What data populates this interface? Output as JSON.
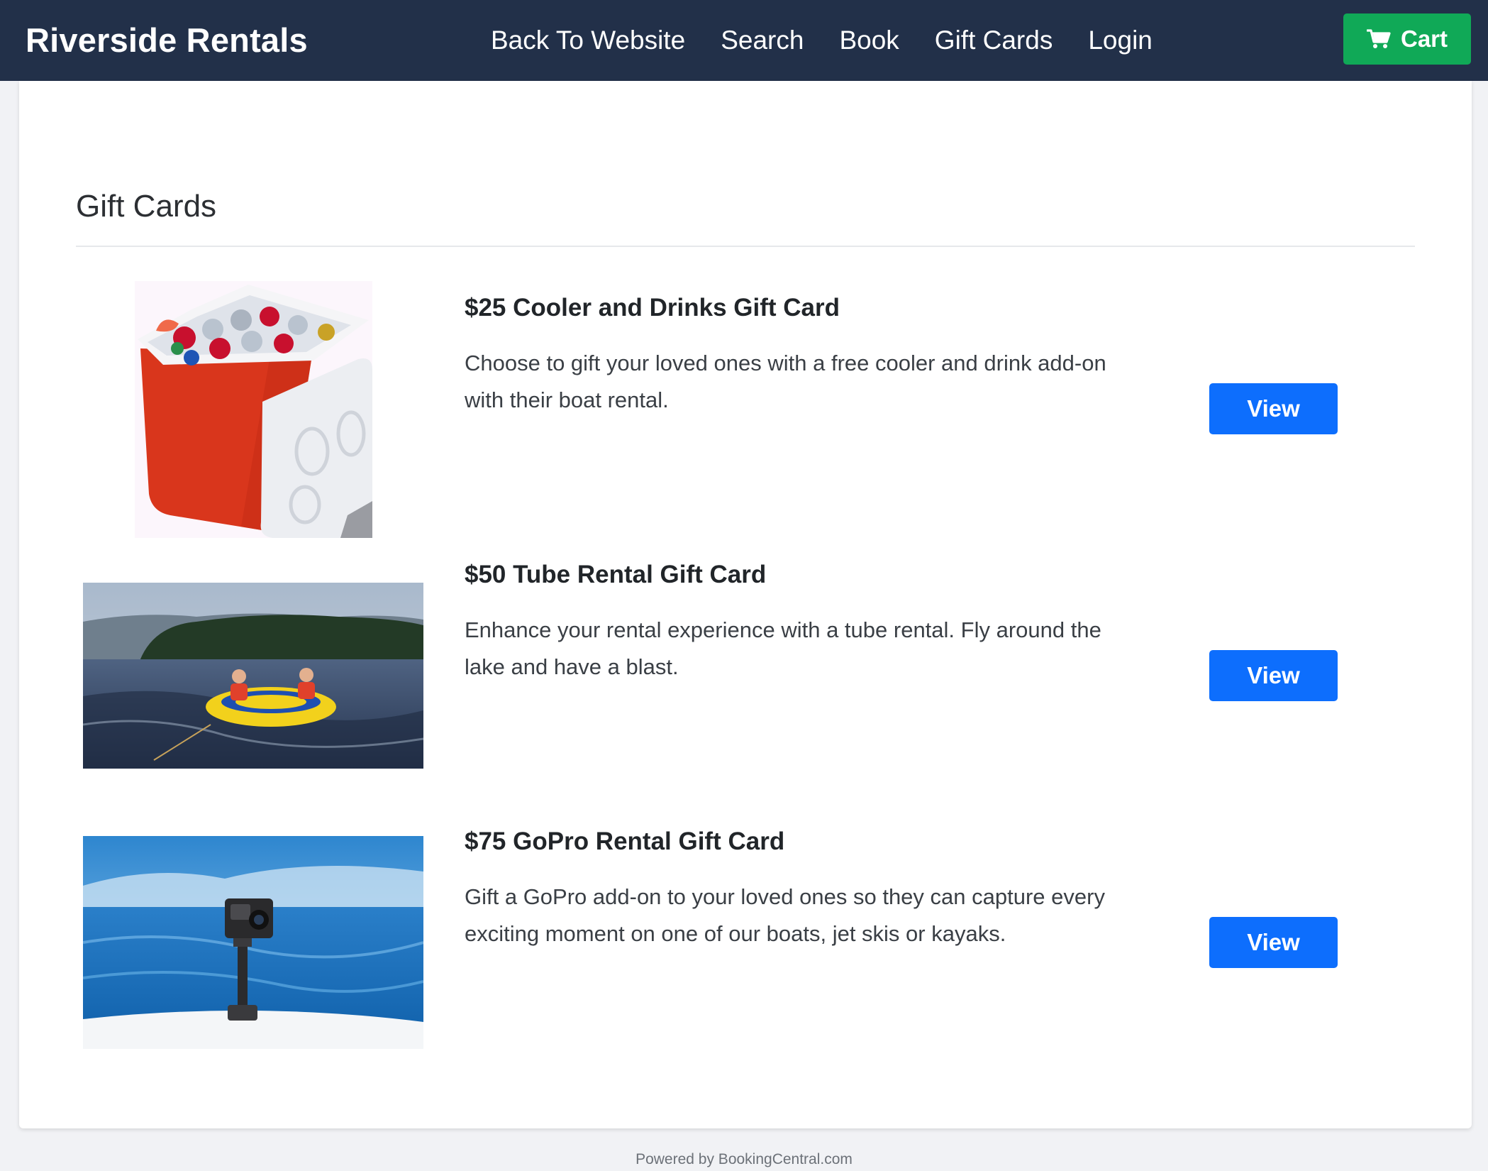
{
  "navbar": {
    "brand": "Riverside Rentals",
    "links": [
      "Back To Website",
      "Search",
      "Book",
      "Gift Cards",
      "Login"
    ],
    "cart_label": "Cart",
    "cart_icon": "shopping-cart-icon"
  },
  "page": {
    "title": "Gift Cards"
  },
  "items": [
    {
      "title": "$25 Cooler and Drinks Gift Card",
      "description": "Choose to gift your loved ones with a free cooler and drink add-on with their boat rental.",
      "button": "View"
    },
    {
      "title": "$50 Tube Rental Gift Card",
      "description": "Enhance your rental experience with a tube rental. Fly around the lake and have a blast.",
      "button": "View"
    },
    {
      "title": "$75 GoPro Rental Gift Card",
      "description": "Gift a GoPro add-on to your loved ones so they can capture every exciting moment on one of our boats, jet skis or kayaks.",
      "button": "View"
    }
  ],
  "footer": {
    "text": "Powered by BookingCentral.com"
  },
  "colors": {
    "navbar": "#223049",
    "cart": "#10a957",
    "view_button": "#0d6efd",
    "background": "#f1f2f5"
  }
}
